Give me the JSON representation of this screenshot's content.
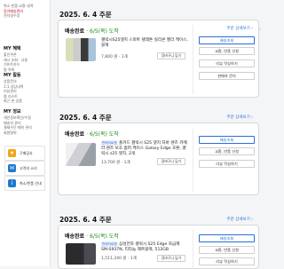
{
  "sidebar": {
    "top_items": [
      "취소·반품·교환 내역",
      "정기배송관리",
      "전자영수증"
    ],
    "groups": [
      {
        "title": "MY 혜택",
        "items": [
          "할인쿠폰",
          "캐시 조회 · 사용",
          "기프트카드",
          "찜 목록"
        ]
      },
      {
        "title": "MY 활동",
        "items": [
          "상품문의",
          "1:1 상담내역",
          "리뷰관리",
          "찜 리스트",
          "최근 본 상품"
        ]
      },
      {
        "title": "MY 정보",
        "items": [
          "개인정보확인/수정",
          "배송지 관리",
          "결제수단·페이 관리",
          "회원탈퇴"
        ]
      }
    ],
    "quick": [
      {
        "label": "구매감사",
        "color": "#f2a516",
        "icon": "gift-icon"
      },
      {
        "label": "고객의 소리",
        "color": "#1f78d1",
        "icon": "chat-icon"
      },
      {
        "label": "취소/반품 안내",
        "color": "#1f78d1",
        "icon": "info-icon"
      }
    ]
  },
  "orders": [
    {
      "date": "2025. 6. 4 주문",
      "detail": "주문 상세보기 ›",
      "status": "배송완료",
      "delivered": "· 6/5(목) 도착",
      "badge": "",
      "product": "갤럭시S25엣지 스마트 텔레톤 실리콘 젤리 케이스, 블랙",
      "price": "7,800 원 · 1개",
      "cart": "장바구니 담기",
      "actions": [
        "배송조회",
        "교환, 반품 신청",
        "리뷰 작성하기",
        "판매자 문의"
      ]
    },
    {
      "date": "2025. 6. 4 주문",
      "detail": "주문 상세보기 ›",
      "status": "배송완료",
      "delivered": "· 6/5(목) 도착",
      "badge": "판매자로켓",
      "product": "폴카드 갤럭시 S25 엣지 자바 렌즈 카메라 렌즈 보호 범퍼 케이스 Galaxy Edge 호환, 갤럭시 s25 엣지, 2개",
      "price": "13,700 원 · 1개",
      "cart": "장바구니 담기",
      "actions": [
        "배송조회",
        "교환, 반품 신청",
        "리뷰 작성하기"
      ]
    },
    {
      "date": "2025. 6. 4 주문",
      "detail": "주문 상세보기 ›",
      "status": "배송완료",
      "delivered": "· 6/5(목) 도착",
      "badge": "판매자로켓",
      "product": "삼성전자 갤럭시 S25 Edge 자급제 SM-S937N, 티타늄 제트블랙, 512GB",
      "price": "1,511,240 원 · 1개",
      "cart": "장바구니 담기",
      "actions": [
        "배송조회",
        "교환, 반품 신청",
        "리뷰 작성하기"
      ]
    }
  ],
  "colors": {
    "accent": "#2a6fd6",
    "delivered": "#1a8c1a"
  }
}
